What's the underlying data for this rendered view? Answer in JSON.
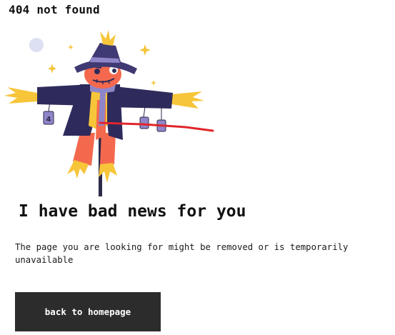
{
  "page": {
    "top_title": "404 not found",
    "headline": "I have bad news for you",
    "message": "The page you are looking for might be removed or is temporarily unavailable",
    "button_label": "back to homepage"
  },
  "illustration": {
    "subject": "scarecrow",
    "can_label": "4",
    "colors": {
      "hat": "#3f3a73",
      "coat": "#2e2b5c",
      "face": "#f4694e",
      "straw": "#f7c53a",
      "scarf": "#8f86c9",
      "pole": "#2c2b4a",
      "red_line": "#e0262b",
      "moon": "#dde0f2"
    }
  }
}
